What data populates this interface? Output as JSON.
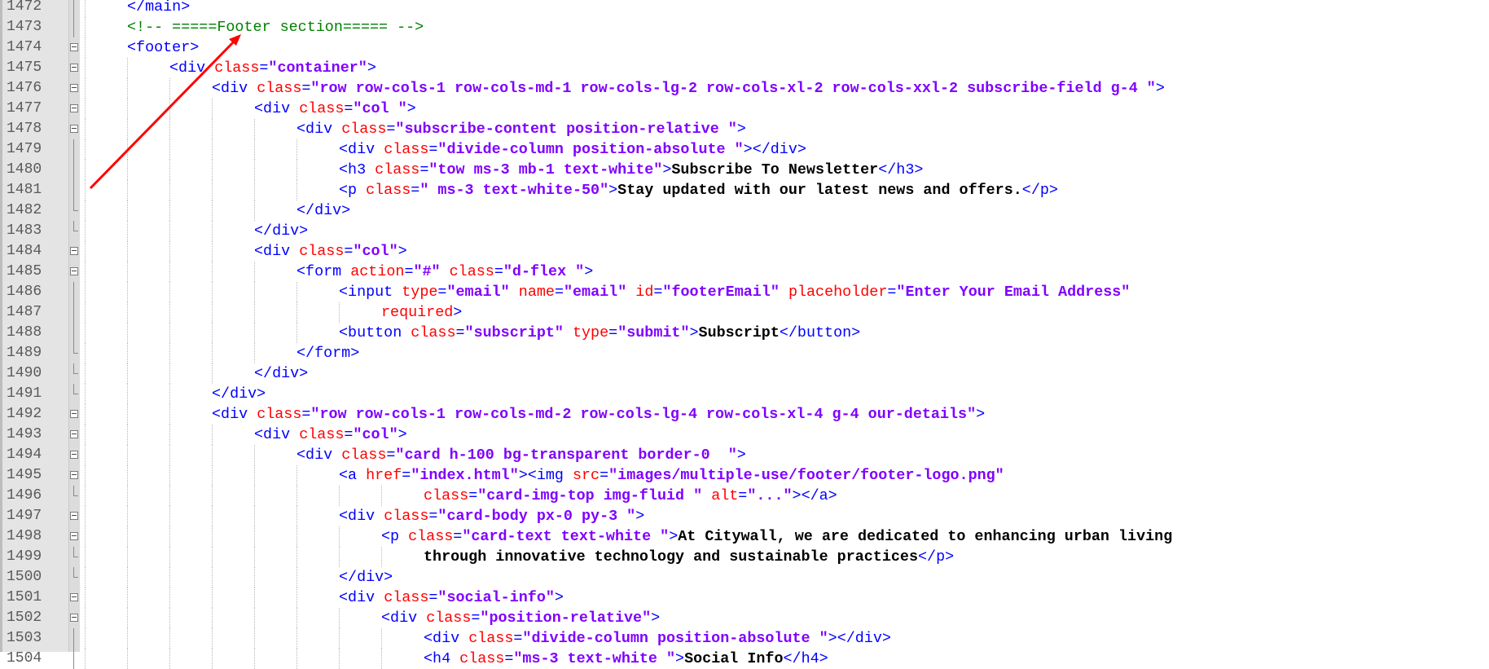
{
  "editor": {
    "language": "html",
    "colors": {
      "tag": "#0000ff",
      "attribute": "#ff0000",
      "string": "#8000ff",
      "text": "#000000",
      "comment": "#008000",
      "annotation_arrow": "#ff0000"
    },
    "lines": [
      {
        "num": "1472",
        "indent": 1,
        "fold": "vline",
        "tokens": [
          {
            "t": "tg",
            "v": "</main>"
          }
        ]
      },
      {
        "num": "1473",
        "indent": 1,
        "fold": "vline",
        "tokens": [
          {
            "t": "cm",
            "v": "<!-- =====Footer section===== -->"
          }
        ]
      },
      {
        "num": "1474",
        "indent": 1,
        "fold": "box",
        "tokens": [
          {
            "t": "tg",
            "v": "<footer>"
          }
        ]
      },
      {
        "num": "1475",
        "indent": 2,
        "fold": "box",
        "tokens": [
          {
            "t": "tg",
            "v": "<div "
          },
          {
            "t": "at",
            "v": "class"
          },
          {
            "t": "tg",
            "v": "="
          },
          {
            "t": "st",
            "v": "\"container\""
          },
          {
            "t": "tg",
            "v": ">"
          }
        ]
      },
      {
        "num": "1476",
        "indent": 3,
        "fold": "box",
        "tokens": [
          {
            "t": "tg",
            "v": "<div "
          },
          {
            "t": "at",
            "v": "class"
          },
          {
            "t": "tg",
            "v": "="
          },
          {
            "t": "st",
            "v": "\"row row-cols-1 row-cols-md-1 row-cols-lg-2 row-cols-xl-2 row-cols-xxl-2 subscribe-field g-4 \""
          },
          {
            "t": "tg",
            "v": ">"
          }
        ]
      },
      {
        "num": "1477",
        "indent": 4,
        "fold": "box",
        "tokens": [
          {
            "t": "tg",
            "v": "<div "
          },
          {
            "t": "at",
            "v": "class"
          },
          {
            "t": "tg",
            "v": "="
          },
          {
            "t": "st",
            "v": "\"col \""
          },
          {
            "t": "tg",
            "v": ">"
          }
        ]
      },
      {
        "num": "1478",
        "indent": 5,
        "fold": "box",
        "tokens": [
          {
            "t": "tg",
            "v": "<div "
          },
          {
            "t": "at",
            "v": "class"
          },
          {
            "t": "tg",
            "v": "="
          },
          {
            "t": "st",
            "v": "\"subscribe-content position-relative \""
          },
          {
            "t": "tg",
            "v": ">"
          }
        ]
      },
      {
        "num": "1479",
        "indent": 6,
        "fold": "vline",
        "tokens": [
          {
            "t": "tg",
            "v": "<div "
          },
          {
            "t": "at",
            "v": "class"
          },
          {
            "t": "tg",
            "v": "="
          },
          {
            "t": "st",
            "v": "\"divide-column position-absolute \""
          },
          {
            "t": "tg",
            "v": "></div>"
          }
        ]
      },
      {
        "num": "1480",
        "indent": 6,
        "fold": "vline",
        "tokens": [
          {
            "t": "tg",
            "v": "<h3 "
          },
          {
            "t": "at",
            "v": "class"
          },
          {
            "t": "tg",
            "v": "="
          },
          {
            "t": "st",
            "v": "\"tow ms-3 mb-1 text-white\""
          },
          {
            "t": "tg",
            "v": ">"
          },
          {
            "t": "tx",
            "v": "Subscribe To Newsletter"
          },
          {
            "t": "tg",
            "v": "</h3>"
          }
        ]
      },
      {
        "num": "1481",
        "indent": 6,
        "fold": "vline",
        "tokens": [
          {
            "t": "tg",
            "v": "<p "
          },
          {
            "t": "at",
            "v": "class"
          },
          {
            "t": "tg",
            "v": "="
          },
          {
            "t": "st",
            "v": "\" ms-3 text-white-50\""
          },
          {
            "t": "tg",
            "v": ">"
          },
          {
            "t": "tx",
            "v": "Stay updated with our latest news and offers."
          },
          {
            "t": "tg",
            "v": "</p>"
          }
        ]
      },
      {
        "num": "1482",
        "indent": 5,
        "fold": "end",
        "tokens": [
          {
            "t": "tg",
            "v": "</div>"
          }
        ]
      },
      {
        "num": "1483",
        "indent": 4,
        "fold": "end",
        "tokens": [
          {
            "t": "tg",
            "v": "</div>"
          }
        ]
      },
      {
        "num": "1484",
        "indent": 4,
        "fold": "box",
        "tokens": [
          {
            "t": "tg",
            "v": "<div "
          },
          {
            "t": "at",
            "v": "class"
          },
          {
            "t": "tg",
            "v": "="
          },
          {
            "t": "st",
            "v": "\"col\""
          },
          {
            "t": "tg",
            "v": ">"
          }
        ]
      },
      {
        "num": "1485",
        "indent": 5,
        "fold": "box",
        "tokens": [
          {
            "t": "tg",
            "v": "<form "
          },
          {
            "t": "at",
            "v": "action"
          },
          {
            "t": "tg",
            "v": "="
          },
          {
            "t": "st",
            "v": "\"#\""
          },
          {
            "t": "tg",
            "v": " "
          },
          {
            "t": "at",
            "v": "class"
          },
          {
            "t": "tg",
            "v": "="
          },
          {
            "t": "st",
            "v": "\"d-flex \""
          },
          {
            "t": "tg",
            "v": ">"
          }
        ]
      },
      {
        "num": "1486",
        "indent": 6,
        "fold": "vline",
        "tokens": [
          {
            "t": "tg",
            "v": "<input "
          },
          {
            "t": "at",
            "v": "type"
          },
          {
            "t": "tg",
            "v": "="
          },
          {
            "t": "st",
            "v": "\"email\""
          },
          {
            "t": "tg",
            "v": " "
          },
          {
            "t": "at",
            "v": "name"
          },
          {
            "t": "tg",
            "v": "="
          },
          {
            "t": "st",
            "v": "\"email\""
          },
          {
            "t": "tg",
            "v": " "
          },
          {
            "t": "at",
            "v": "id"
          },
          {
            "t": "tg",
            "v": "="
          },
          {
            "t": "st",
            "v": "\"footerEmail\""
          },
          {
            "t": "tg",
            "v": " "
          },
          {
            "t": "at",
            "v": "placeholder"
          },
          {
            "t": "tg",
            "v": "="
          },
          {
            "t": "st",
            "v": "\"Enter Your Email Address\""
          }
        ]
      },
      {
        "num": "1487",
        "indent": 7,
        "fold": "vline",
        "tokens": [
          {
            "t": "at",
            "v": "required"
          },
          {
            "t": "tg",
            "v": ">"
          }
        ]
      },
      {
        "num": "1488",
        "indent": 6,
        "fold": "vline",
        "tokens": [
          {
            "t": "tg",
            "v": "<button "
          },
          {
            "t": "at",
            "v": "class"
          },
          {
            "t": "tg",
            "v": "="
          },
          {
            "t": "st",
            "v": "\"subscript\""
          },
          {
            "t": "tg",
            "v": " "
          },
          {
            "t": "at",
            "v": "type"
          },
          {
            "t": "tg",
            "v": "="
          },
          {
            "t": "st",
            "v": "\"submit\""
          },
          {
            "t": "tg",
            "v": ">"
          },
          {
            "t": "tx",
            "v": "Subscript"
          },
          {
            "t": "tg",
            "v": "</button>"
          }
        ]
      },
      {
        "num": "1489",
        "indent": 5,
        "fold": "end",
        "tokens": [
          {
            "t": "tg",
            "v": "</form>"
          }
        ]
      },
      {
        "num": "1490",
        "indent": 4,
        "fold": "end",
        "tokens": [
          {
            "t": "tg",
            "v": "</div>"
          }
        ]
      },
      {
        "num": "1491",
        "indent": 3,
        "fold": "end",
        "tokens": [
          {
            "t": "tg",
            "v": "</div>"
          }
        ]
      },
      {
        "num": "1492",
        "indent": 3,
        "fold": "box",
        "tokens": [
          {
            "t": "tg",
            "v": "<div "
          },
          {
            "t": "at",
            "v": "class"
          },
          {
            "t": "tg",
            "v": "="
          },
          {
            "t": "st",
            "v": "\"row row-cols-1 row-cols-md-2 row-cols-lg-4 row-cols-xl-4 g-4 our-details\""
          },
          {
            "t": "tg",
            "v": ">"
          }
        ]
      },
      {
        "num": "1493",
        "indent": 4,
        "fold": "box",
        "tokens": [
          {
            "t": "tg",
            "v": "<div "
          },
          {
            "t": "at",
            "v": "class"
          },
          {
            "t": "tg",
            "v": "="
          },
          {
            "t": "st",
            "v": "\"col\""
          },
          {
            "t": "tg",
            "v": ">"
          }
        ]
      },
      {
        "num": "1494",
        "indent": 5,
        "fold": "box",
        "tokens": [
          {
            "t": "tg",
            "v": "<div "
          },
          {
            "t": "at",
            "v": "class"
          },
          {
            "t": "tg",
            "v": "="
          },
          {
            "t": "st",
            "v": "\"card h-100 bg-transparent border-0  \""
          },
          {
            "t": "tg",
            "v": ">"
          }
        ]
      },
      {
        "num": "1495",
        "indent": 6,
        "fold": "box",
        "tokens": [
          {
            "t": "tg",
            "v": "<a "
          },
          {
            "t": "at",
            "v": "href"
          },
          {
            "t": "tg",
            "v": "="
          },
          {
            "t": "st",
            "v": "\"index.html\""
          },
          {
            "t": "tg",
            "v": "><img "
          },
          {
            "t": "at",
            "v": "src"
          },
          {
            "t": "tg",
            "v": "="
          },
          {
            "t": "st",
            "v": "\"images/multiple-use/footer/footer-logo.png\""
          }
        ]
      },
      {
        "num": "1496",
        "indent": 8,
        "fold": "end",
        "tokens": [
          {
            "t": "at",
            "v": "class"
          },
          {
            "t": "tg",
            "v": "="
          },
          {
            "t": "st",
            "v": "\"card-img-top img-fluid \""
          },
          {
            "t": "tg",
            "v": " "
          },
          {
            "t": "at",
            "v": "alt"
          },
          {
            "t": "tg",
            "v": "="
          },
          {
            "t": "st",
            "v": "\"...\""
          },
          {
            "t": "tg",
            "v": "></a>"
          }
        ]
      },
      {
        "num": "1497",
        "indent": 6,
        "fold": "box",
        "tokens": [
          {
            "t": "tg",
            "v": "<div "
          },
          {
            "t": "at",
            "v": "class"
          },
          {
            "t": "tg",
            "v": "="
          },
          {
            "t": "st",
            "v": "\"card-body px-0 py-3 \""
          },
          {
            "t": "tg",
            "v": ">"
          }
        ]
      },
      {
        "num": "1498",
        "indent": 7,
        "fold": "box",
        "tokens": [
          {
            "t": "tg",
            "v": "<p "
          },
          {
            "t": "at",
            "v": "class"
          },
          {
            "t": "tg",
            "v": "="
          },
          {
            "t": "st",
            "v": "\"card-text text-white \""
          },
          {
            "t": "tg",
            "v": ">"
          },
          {
            "t": "tx",
            "v": "At Citywall, we are dedicated to enhancing urban living"
          }
        ]
      },
      {
        "num": "1499",
        "indent": 8,
        "fold": "end",
        "tokens": [
          {
            "t": "tx",
            "v": "through innovative technology and sustainable practices"
          },
          {
            "t": "tg",
            "v": "</p>"
          }
        ]
      },
      {
        "num": "1500",
        "indent": 6,
        "fold": "end",
        "tokens": [
          {
            "t": "tg",
            "v": "</div>"
          }
        ]
      },
      {
        "num": "1501",
        "indent": 6,
        "fold": "box",
        "tokens": [
          {
            "t": "tg",
            "v": "<div "
          },
          {
            "t": "at",
            "v": "class"
          },
          {
            "t": "tg",
            "v": "="
          },
          {
            "t": "st",
            "v": "\"social-info\""
          },
          {
            "t": "tg",
            "v": ">"
          }
        ]
      },
      {
        "num": "1502",
        "indent": 7,
        "fold": "box",
        "tokens": [
          {
            "t": "tg",
            "v": "<div "
          },
          {
            "t": "at",
            "v": "class"
          },
          {
            "t": "tg",
            "v": "="
          },
          {
            "t": "st",
            "v": "\"position-relative\""
          },
          {
            "t": "tg",
            "v": ">"
          }
        ]
      },
      {
        "num": "1503",
        "indent": 8,
        "fold": "vline",
        "tokens": [
          {
            "t": "tg",
            "v": "<div "
          },
          {
            "t": "at",
            "v": "class"
          },
          {
            "t": "tg",
            "v": "="
          },
          {
            "t": "st",
            "v": "\"divide-column position-absolute \""
          },
          {
            "t": "tg",
            "v": "></div>"
          }
        ]
      },
      {
        "num": "1504",
        "indent": 8,
        "fold": "vline",
        "tokens": [
          {
            "t": "tg",
            "v": "<h4 "
          },
          {
            "t": "at",
            "v": "class"
          },
          {
            "t": "tg",
            "v": "="
          },
          {
            "t": "st",
            "v": "\"ms-3 text-white \""
          },
          {
            "t": "tg",
            "v": ">"
          },
          {
            "t": "tx",
            "v": "Social Info"
          },
          {
            "t": "tg",
            "v": "</h4>"
          }
        ]
      }
    ]
  }
}
